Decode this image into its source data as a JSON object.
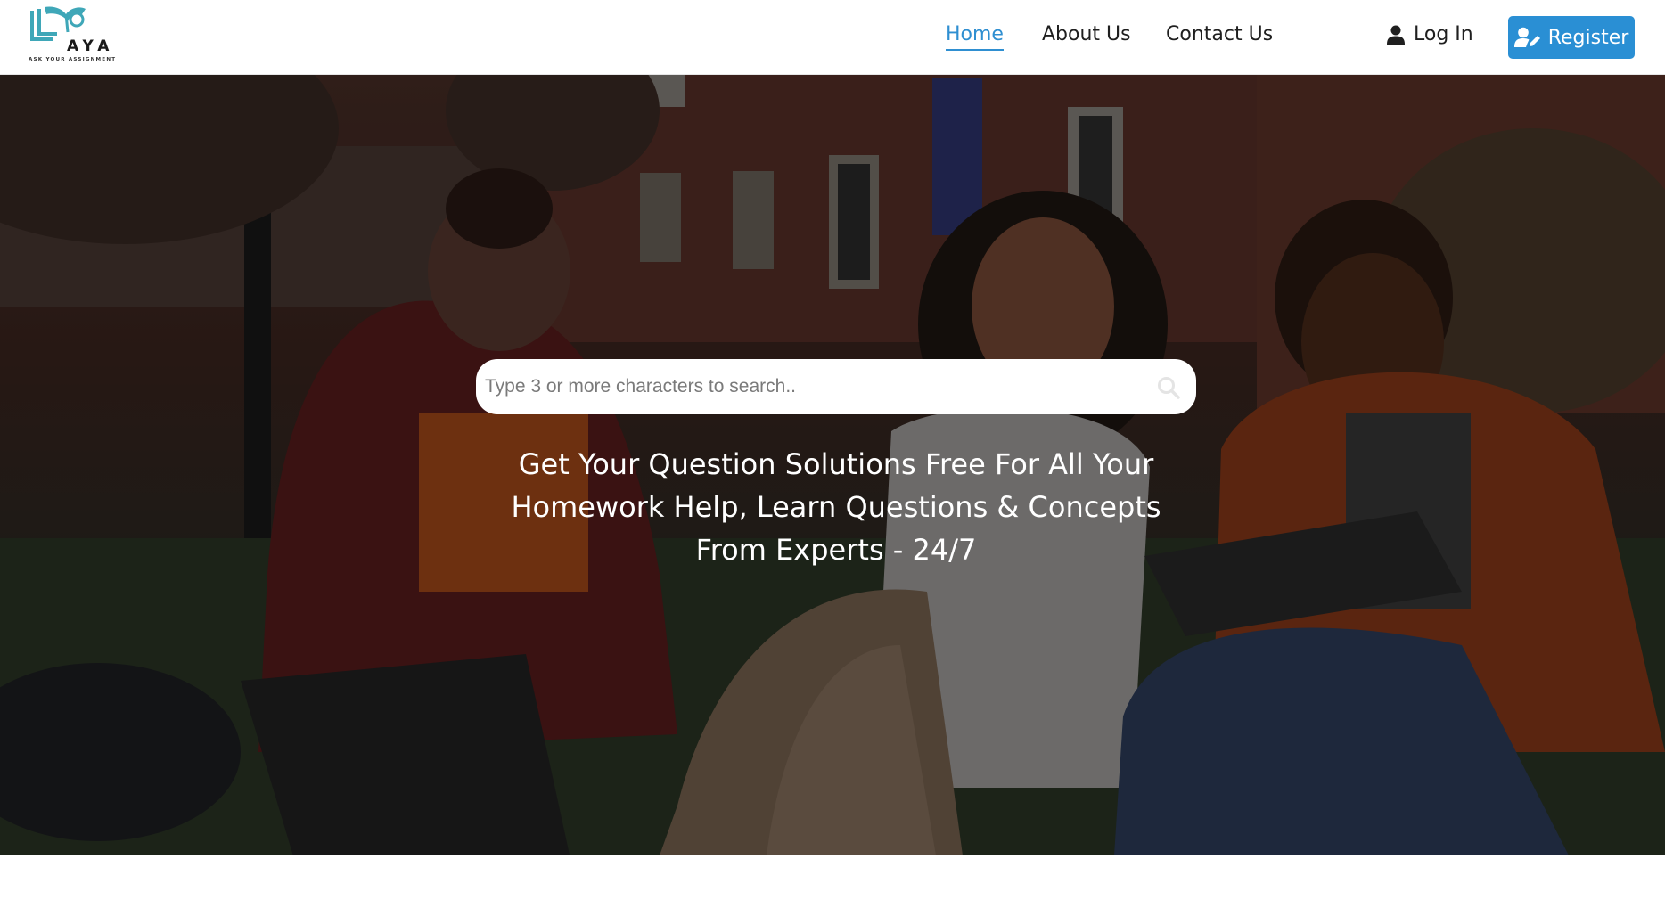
{
  "brand": {
    "name": "AYA",
    "tagline": "ASK YOUR ASSIGNMENT",
    "colors": {
      "accent": "#2a8fd4",
      "logo": "#3fa7b8"
    }
  },
  "nav": {
    "items": [
      {
        "label": "Home",
        "active": true
      },
      {
        "label": "About Us",
        "active": false
      },
      {
        "label": "Contact Us",
        "active": false
      }
    ],
    "login_label": "Log In",
    "register_label": "Register",
    "icons": {
      "login": "user-icon",
      "register": "user-edit-icon"
    }
  },
  "hero": {
    "search": {
      "placeholder": "Type 3 or more characters to search..",
      "value": "",
      "icon": "search-icon"
    },
    "headline_lines": [
      "Get Your Question Solutions Free For All Your",
      "Homework Help, Learn Questions & Concepts",
      "From Experts - 24/7"
    ]
  }
}
